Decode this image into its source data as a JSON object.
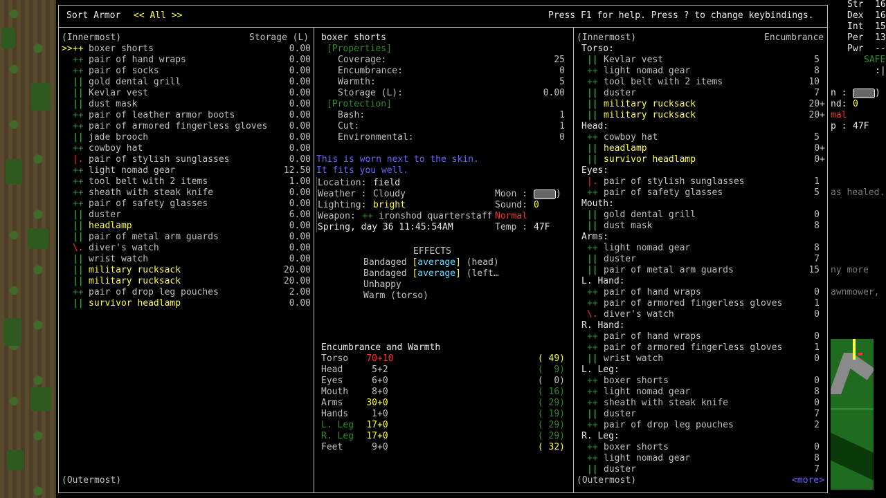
{
  "header": {
    "title": "Sort Armor",
    "filter": "<< All >>",
    "help": "Press F1 for help. Press ? to change keybindings."
  },
  "left_panel": {
    "top_label": "(Innermost)",
    "column_label": "Storage (L)",
    "bottom_label": "(Outermost)",
    "items": [
      {
        "cursor": ">>",
        "mark": "++",
        "mcolor": "y",
        "name": "boxer shorts",
        "ncolor": "g",
        "value": "0.00"
      },
      {
        "cursor": "",
        "mark": "++",
        "mcolor": "dgr",
        "name": "pair of hand wraps",
        "ncolor": "g",
        "value": "0.00"
      },
      {
        "cursor": "",
        "mark": "++",
        "mcolor": "dgr",
        "name": "pair of socks",
        "ncolor": "g",
        "value": "0.00"
      },
      {
        "cursor": "",
        "mark": "||",
        "mcolor": "gr",
        "name": "gold dental grill",
        "ncolor": "g",
        "value": "0.00"
      },
      {
        "cursor": "",
        "mark": "||",
        "mcolor": "gr",
        "name": "Kevlar vest",
        "ncolor": "g",
        "value": "0.00"
      },
      {
        "cursor": "",
        "mark": "||",
        "mcolor": "gr",
        "name": "dust mask",
        "ncolor": "g",
        "value": "0.00"
      },
      {
        "cursor": "",
        "mark": "++",
        "mcolor": "dgr",
        "name": "pair of leather armor boots",
        "ncolor": "g",
        "value": "0.00"
      },
      {
        "cursor": "",
        "mark": "++",
        "mcolor": "dgr",
        "name": "pair of armored fingerless gloves",
        "ncolor": "g",
        "value": "0.00"
      },
      {
        "cursor": "",
        "mark": "||",
        "mcolor": "gr",
        "name": "jade brooch",
        "ncolor": "g",
        "value": "0.00"
      },
      {
        "cursor": "",
        "mark": "++",
        "mcolor": "dgr",
        "name": "cowboy hat",
        "ncolor": "g",
        "value": "0.00"
      },
      {
        "cursor": "",
        "mark": "|.",
        "mcolor": "r",
        "name": "pair of stylish sunglasses",
        "ncolor": "g",
        "value": "0.00"
      },
      {
        "cursor": "",
        "mark": "++",
        "mcolor": "dgr",
        "name": "light nomad gear",
        "ncolor": "g",
        "value": "12.50"
      },
      {
        "cursor": "",
        "mark": "++",
        "mcolor": "dgr",
        "name": "tool belt with 2 items",
        "ncolor": "g",
        "value": "1.00"
      },
      {
        "cursor": "",
        "mark": "++",
        "mcolor": "dgr",
        "name": "sheath with steak knife",
        "ncolor": "g",
        "value": "0.00"
      },
      {
        "cursor": "",
        "mark": "++",
        "mcolor": "dgr",
        "name": "pair of safety glasses",
        "ncolor": "g",
        "value": "0.00"
      },
      {
        "cursor": "",
        "mark": "||",
        "mcolor": "gr",
        "name": "duster",
        "ncolor": "g",
        "value": "6.00"
      },
      {
        "cursor": "",
        "mark": "||",
        "mcolor": "gr",
        "name": "headlamp",
        "ncolor": "y",
        "value": "0.00"
      },
      {
        "cursor": "",
        "mark": "||",
        "mcolor": "gr",
        "name": "pair of metal arm guards",
        "ncolor": "g",
        "value": "0.00"
      },
      {
        "cursor": "",
        "mark": "\\.",
        "mcolor": "r",
        "name": "diver's watch",
        "ncolor": "g",
        "value": "0.00"
      },
      {
        "cursor": "",
        "mark": "||",
        "mcolor": "gr",
        "name": "wrist watch",
        "ncolor": "g",
        "value": "0.00"
      },
      {
        "cursor": "",
        "mark": "||",
        "mcolor": "gr",
        "name": "military rucksack",
        "ncolor": "y",
        "value": "20.00"
      },
      {
        "cursor": "",
        "mark": "||",
        "mcolor": "gr",
        "name": "military rucksack",
        "ncolor": "y",
        "value": "20.00"
      },
      {
        "cursor": "",
        "mark": "++",
        "mcolor": "dgr",
        "name": "pair of drop leg pouches",
        "ncolor": "g",
        "value": "2.00"
      },
      {
        "cursor": "",
        "mark": "||",
        "mcolor": "gr",
        "name": "survivor headlamp",
        "ncolor": "y",
        "value": "0.00"
      }
    ]
  },
  "middle_panel": {
    "item_name": "boxer shorts",
    "properties_label": "[Properties]",
    "properties": [
      {
        "label": "Coverage:",
        "value": "25"
      },
      {
        "label": "Encumbrance:",
        "value": "0"
      },
      {
        "label": "Warmth:",
        "value": "5"
      },
      {
        "label": "Storage (L):",
        "value": "0.00"
      }
    ],
    "protection_label": "[Protection]",
    "protection": [
      {
        "label": "Bash:",
        "value": "1"
      },
      {
        "label": "Cut:",
        "value": "1"
      },
      {
        "label": "Environmental:",
        "value": "0"
      }
    ],
    "notes": [
      "This is worn next to the skin.",
      "It fits you well."
    ],
    "status": {
      "location_label": "Location:",
      "location": "field",
      "weather_label": "Weather :",
      "weather": "Cloudy",
      "lighting_label": "Lighting:",
      "lighting": "bright",
      "weapon_label": "Weapon:",
      "weapon_mark": "++",
      "weapon": "ironshod quarterstaff",
      "weapon_state": "Normal",
      "date": "Spring, day 36 11:45:54AM",
      "moon_label": "Moon :",
      "moon": "( )",
      "sound_label": "Sound:",
      "sound": "0",
      "temp_label": "Temp :",
      "temp": "47F"
    },
    "effects_title": "EFFECTS",
    "effects": [
      {
        "pre": "Bandaged ",
        "b1": "[",
        "mid": "average",
        "b2": "]",
        "post": " (head)"
      },
      {
        "pre": "Bandaged ",
        "b1": "[",
        "mid": "average",
        "b2": "]",
        "post": " (left…"
      },
      {
        "pre": "Unhappy",
        "b1": "",
        "mid": "",
        "b2": "",
        "post": ""
      },
      {
        "pre": "Warm (torso)",
        "b1": "",
        "mid": "",
        "b2": "",
        "post": ""
      }
    ],
    "enc_title": "Encumbrance and Warmth",
    "enc_rows": [
      {
        "part": "Torso",
        "pcolor": "g",
        "a": "70",
        "acolor": "r",
        "b": "+10",
        "bcolor": "r",
        "warm": "( 49)",
        "wcolor": "y"
      },
      {
        "part": "Head",
        "pcolor": "g",
        "a": "5",
        "acolor": "g",
        "b": "+2",
        "bcolor": "g",
        "warm": "(  9)",
        "wcolor": "dgr"
      },
      {
        "part": "Eyes",
        "pcolor": "g",
        "a": "6",
        "acolor": "g",
        "b": "+0",
        "bcolor": "g",
        "warm": "(  0)",
        "wcolor": "g"
      },
      {
        "part": "Mouth",
        "pcolor": "g",
        "a": "8",
        "acolor": "g",
        "b": "+0",
        "bcolor": "g",
        "warm": "( 16)",
        "wcolor": "dgr"
      },
      {
        "part": "Arms",
        "pcolor": "g",
        "a": "30",
        "acolor": "y",
        "b": "+0",
        "bcolor": "y",
        "warm": "( 29)",
        "wcolor": "dgr"
      },
      {
        "part": "Hands",
        "pcolor": "g",
        "a": "1",
        "acolor": "g",
        "b": "+0",
        "bcolor": "g",
        "warm": "( 19)",
        "wcolor": "dgr"
      },
      {
        "part": "L. Leg",
        "pcolor": "dgr",
        "a": "17",
        "acolor": "y",
        "b": "+0",
        "bcolor": "y",
        "warm": "( 29)",
        "wcolor": "dgr"
      },
      {
        "part": "R. Leg",
        "pcolor": "dgr",
        "a": "17",
        "acolor": "y",
        "b": "+0",
        "bcolor": "y",
        "warm": "( 29)",
        "wcolor": "dgr"
      },
      {
        "part": "Feet",
        "pcolor": "g",
        "a": "9",
        "acolor": "g",
        "b": "+0",
        "bcolor": "g",
        "warm": "( 32)",
        "wcolor": "y"
      }
    ]
  },
  "right_panel": {
    "top_label": "(Innermost)",
    "column_label": "Encumbrance",
    "bottom_label": "(Outermost)",
    "more": "<more>",
    "rows": [
      {
        "type": "h",
        "text": "Torso:"
      },
      {
        "type": "i",
        "mark": "||",
        "mcolor": "gr",
        "name": "Kevlar vest",
        "ncolor": "g",
        "value": "5"
      },
      {
        "type": "i",
        "mark": "++",
        "mcolor": "dgr",
        "name": "light nomad gear",
        "ncolor": "g",
        "value": "8"
      },
      {
        "type": "i",
        "mark": "++",
        "mcolor": "dgr",
        "name": "tool belt with 2 items",
        "ncolor": "g",
        "value": "10"
      },
      {
        "type": "i",
        "mark": "||",
        "mcolor": "gr",
        "name": "duster",
        "ncolor": "g",
        "value": "7"
      },
      {
        "type": "i",
        "mark": "||",
        "mcolor": "gr",
        "name": "military rucksack",
        "ncolor": "y",
        "value": "20+"
      },
      {
        "type": "i",
        "mark": "||",
        "mcolor": "gr",
        "name": "military rucksack",
        "ncolor": "y",
        "value": "20+"
      },
      {
        "type": "h",
        "text": "Head:"
      },
      {
        "type": "i",
        "mark": "++",
        "mcolor": "dgr",
        "name": "cowboy hat",
        "ncolor": "g",
        "value": "5"
      },
      {
        "type": "i",
        "mark": "||",
        "mcolor": "gr",
        "name": "headlamp",
        "ncolor": "y",
        "value": "0+"
      },
      {
        "type": "i",
        "mark": "||",
        "mcolor": "gr",
        "name": "survivor headlamp",
        "ncolor": "y",
        "value": "0+"
      },
      {
        "type": "h",
        "text": "Eyes:"
      },
      {
        "type": "i",
        "mark": "|.",
        "mcolor": "r",
        "name": "pair of stylish sunglasses",
        "ncolor": "g",
        "value": "1"
      },
      {
        "type": "i",
        "mark": "++",
        "mcolor": "dgr",
        "name": "pair of safety glasses",
        "ncolor": "g",
        "value": "5"
      },
      {
        "type": "h",
        "text": "Mouth:"
      },
      {
        "type": "i",
        "mark": "||",
        "mcolor": "gr",
        "name": "gold dental grill",
        "ncolor": "g",
        "value": "0"
      },
      {
        "type": "i",
        "mark": "||",
        "mcolor": "gr",
        "name": "dust mask",
        "ncolor": "g",
        "value": "8"
      },
      {
        "type": "h",
        "text": "Arms:"
      },
      {
        "type": "i",
        "mark": "++",
        "mcolor": "dgr",
        "name": "light nomad gear",
        "ncolor": "g",
        "value": "8"
      },
      {
        "type": "i",
        "mark": "||",
        "mcolor": "gr",
        "name": "duster",
        "ncolor": "g",
        "value": "7"
      },
      {
        "type": "i",
        "mark": "||",
        "mcolor": "gr",
        "name": "pair of metal arm guards",
        "ncolor": "g",
        "value": "15"
      },
      {
        "type": "h",
        "text": "L. Hand:"
      },
      {
        "type": "i",
        "mark": "++",
        "mcolor": "dgr",
        "name": "pair of hand wraps",
        "ncolor": "g",
        "value": "0"
      },
      {
        "type": "i",
        "mark": "++",
        "mcolor": "dgr",
        "name": "pair of armored fingerless gloves",
        "ncolor": "g",
        "value": "1"
      },
      {
        "type": "i",
        "mark": "\\.",
        "mcolor": "r",
        "name": "diver's watch",
        "ncolor": "g",
        "value": "0"
      },
      {
        "type": "h",
        "text": "R. Hand:"
      },
      {
        "type": "i",
        "mark": "++",
        "mcolor": "dgr",
        "name": "pair of hand wraps",
        "ncolor": "g",
        "value": "0"
      },
      {
        "type": "i",
        "mark": "++",
        "mcolor": "dgr",
        "name": "pair of armored fingerless gloves",
        "ncolor": "g",
        "value": "1"
      },
      {
        "type": "i",
        "mark": "||",
        "mcolor": "gr",
        "name": "wrist watch",
        "ncolor": "g",
        "value": "0"
      },
      {
        "type": "h",
        "text": "L. Leg:"
      },
      {
        "type": "i",
        "mark": "++",
        "mcolor": "dgr",
        "name": "boxer shorts",
        "ncolor": "g",
        "value": "0"
      },
      {
        "type": "i",
        "mark": "++",
        "mcolor": "dgr",
        "name": "light nomad gear",
        "ncolor": "g",
        "value": "8"
      },
      {
        "type": "i",
        "mark": "++",
        "mcolor": "dgr",
        "name": "sheath with steak knife",
        "ncolor": "g",
        "value": "0"
      },
      {
        "type": "i",
        "mark": "||",
        "mcolor": "gr",
        "name": "duster",
        "ncolor": "g",
        "value": "7"
      },
      {
        "type": "i",
        "mark": "++",
        "mcolor": "dgr",
        "name": "pair of drop leg pouches",
        "ncolor": "g",
        "value": "2"
      },
      {
        "type": "h",
        "text": "R. Leg:"
      },
      {
        "type": "i",
        "mark": "++",
        "mcolor": "dgr",
        "name": "boxer shorts",
        "ncolor": "g",
        "value": "0"
      },
      {
        "type": "i",
        "mark": "++",
        "mcolor": "dgr",
        "name": "light nomad gear",
        "ncolor": "g",
        "value": "8"
      },
      {
        "type": "i",
        "mark": "||",
        "mcolor": "gr",
        "name": "duster",
        "ncolor": "g",
        "value": "7"
      }
    ]
  },
  "sidebar": {
    "stats": [
      {
        "label": "Str",
        "value": "16"
      },
      {
        "label": "Dex",
        "value": "16"
      },
      {
        "label": "Int",
        "value": "15"
      },
      {
        "label": "Per",
        "value": "13"
      },
      {
        "label": "Pwr",
        "value": "--"
      }
    ],
    "safe": "SAFE",
    "colon": ":|",
    "n_label": "n :",
    "nd_label": "nd:",
    "nd_value": "0",
    "mal": "mal",
    "p_label": "p :",
    "p_value": "47F",
    "msg1": "as healed.",
    "msg2": "ny more",
    "msg3": "awnmower,"
  },
  "colors": {
    "yellow": "#ffff3c",
    "green": "#3cdc3c",
    "dark_green": "#2f8a2f",
    "red": "#ff3232",
    "blue": "#6464ff",
    "gray": "#c0c0c0"
  }
}
